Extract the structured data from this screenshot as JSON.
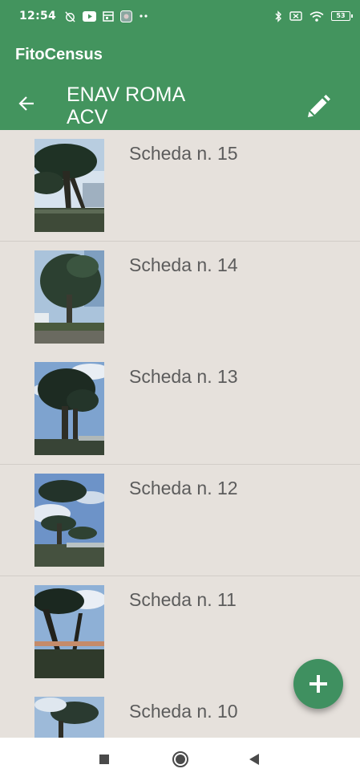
{
  "status_bar": {
    "time": "12:54",
    "left_icons": [
      "alarm-off-icon",
      "youtube-icon",
      "calendar-icon",
      "photo-icon",
      "more-dots-icon"
    ],
    "right_icons": [
      "bluetooth-icon",
      "no-sim-icon",
      "wifi-icon",
      "battery-icon"
    ],
    "battery": "53"
  },
  "app": {
    "title": "FitoCensus"
  },
  "toolbar": {
    "title": "ENAV ROMA ACV"
  },
  "cards": [
    {
      "label": "Scheda n. 15"
    },
    {
      "label": "Scheda n. 14"
    },
    {
      "label": "Scheda n. 13"
    },
    {
      "label": "Scheda n. 12"
    },
    {
      "label": "Scheda n. 11"
    },
    {
      "label": "Scheda n. 10"
    }
  ],
  "colors": {
    "primary": "#43945e",
    "background": "#e6e1dc",
    "fab": "#3f9060",
    "item_text": "#5c5c5c"
  }
}
